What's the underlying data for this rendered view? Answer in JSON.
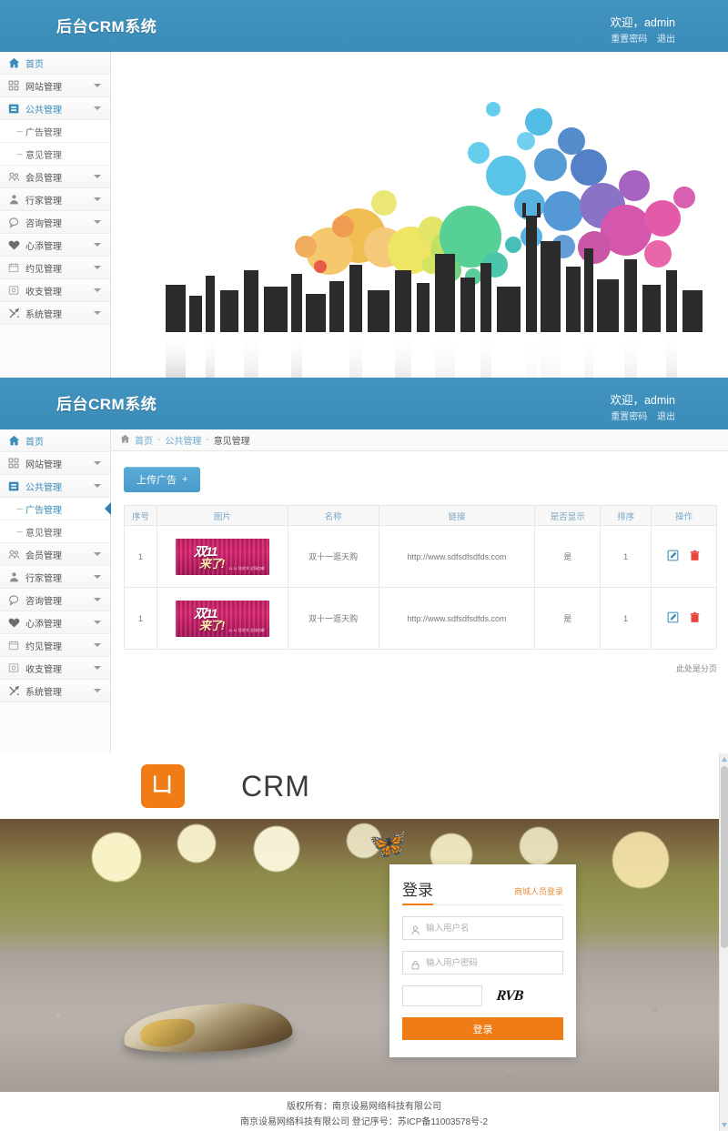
{
  "app": {
    "brand": "后台CRM系统",
    "welcome": "欢迎，admin",
    "reset_password": "重置密码",
    "logout": "退出"
  },
  "sidebar": {
    "items": [
      {
        "label": "首页",
        "icon": "home-icon",
        "caret": false,
        "active": true
      },
      {
        "label": "网站管理",
        "icon": "grid-icon",
        "caret": true,
        "active": false
      },
      {
        "label": "公共管理",
        "icon": "folder-icon",
        "caret": true,
        "active": true
      },
      {
        "label": "会员管理",
        "icon": "users-icon",
        "caret": true,
        "active": false
      },
      {
        "label": "行家管理",
        "icon": "expert-icon",
        "caret": true,
        "active": false
      },
      {
        "label": "咨询管理",
        "icon": "chat-icon",
        "caret": true,
        "active": false
      },
      {
        "label": "心添管理",
        "icon": "heart-icon",
        "caret": true,
        "active": false
      },
      {
        "label": "约见管理",
        "icon": "calendar-icon",
        "caret": true,
        "active": false
      },
      {
        "label": "收支管理",
        "icon": "money-icon",
        "caret": true,
        "active": false
      },
      {
        "label": "系统管理",
        "icon": "tools-icon",
        "caret": true,
        "active": false
      }
    ],
    "submenu": [
      {
        "label": "广告管理",
        "active": true
      },
      {
        "label": "意见管理",
        "active": false
      }
    ],
    "submenu2": [
      {
        "label": "广告管理",
        "active": true
      },
      {
        "label": "意见管理",
        "active": false
      }
    ]
  },
  "breadcrumb": {
    "home": "首页",
    "sep": "-",
    "parent": "公共管理",
    "current": "意见管理"
  },
  "toolbar": {
    "upload_label": "上传广告",
    "upload_plus": "+"
  },
  "table": {
    "headers": [
      "序号",
      "图片",
      "名称",
      "链接",
      "是否显示",
      "排序",
      "操作"
    ],
    "rows": [
      {
        "index": "1",
        "image_alt": "双11来了广告图",
        "image_text1": "双11",
        "image_text2": "来了!",
        "image_text3": "11.11 狂欢节\n全场包邮",
        "name": "双十一逛天购",
        "link": "http://www.sdfsdfsdfds.com",
        "visible": "是",
        "sort": "1",
        "edit_icon": "edit-icon",
        "delete_icon": "trash-icon"
      },
      {
        "index": "1",
        "image_alt": "双11来了广告图",
        "image_text1": "双11",
        "image_text2": "来了!",
        "image_text3": "11.11 狂欢节\n全场包邮",
        "name": "双十一逛天购",
        "link": "http://www.sdfsdfsdfds.com",
        "visible": "是",
        "sort": "1",
        "edit_icon": "edit-icon",
        "delete_icon": "trash-icon"
      }
    ],
    "pager_note": "此处是分页"
  },
  "logo": {
    "mark": "凵",
    "text": "CRM",
    "color": "#ef7c14"
  },
  "login": {
    "title": "登录",
    "alt_link": "商城人员登录",
    "username_placeholder": "输入用户名",
    "username_value": "",
    "password_placeholder": "输入用户密码",
    "password_value": "",
    "captcha_value": "",
    "captcha_text": "RVB",
    "submit_label": "登录",
    "user_icon": "user-icon",
    "lock_icon": "lock-icon"
  },
  "footer": {
    "line1": "版权所有：南京设易网络科技有限公司",
    "line2": "南京设易网络科技有限公司 登记序号：苏ICP备11003578号-2"
  },
  "colors": {
    "header_blue": "#3f91bd",
    "accent_orange": "#ef7c14",
    "link_blue": "#6aaad0",
    "danger_red": "#e8453c"
  }
}
